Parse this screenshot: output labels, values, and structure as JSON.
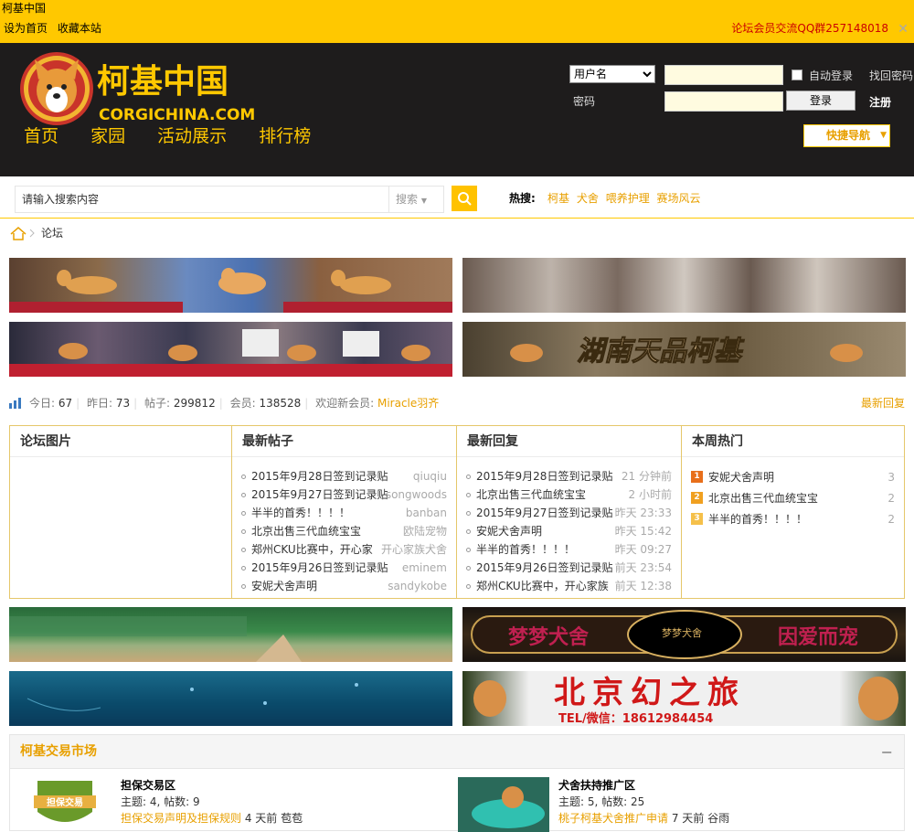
{
  "window_title": "柯基中国",
  "topbar": {
    "set_home": "设为首页",
    "bookmark": "收藏本站",
    "qq_group": "论坛会员交流QQ群257148018",
    "close_icon": "close-icon"
  },
  "logo": {
    "cn": "柯基中国",
    "en": "CORGICHINA.COM"
  },
  "nav": [
    "首页",
    "家园",
    "活动展示",
    "排行榜"
  ],
  "login": {
    "username_select": "用户名",
    "auto_login": "自动登录",
    "find_password": "找回密码",
    "password_label": "密码",
    "login_button": "登录",
    "register": "注册"
  },
  "quick_nav": "快捷导航",
  "search": {
    "placeholder": "请输入搜索内容",
    "type": "搜索",
    "hot_label": "热搜:",
    "hot_links": [
      "柯基",
      "犬舍",
      "喂养护理",
      "赛场风云"
    ]
  },
  "breadcrumb": {
    "current": "论坛"
  },
  "banners": {
    "kennel_right": "湖南天品柯基",
    "dream_left": "梦梦犬舍",
    "dream_right": "因爱而宠",
    "dream_logo": "梦梦犬舍",
    "travel_title": "北京幻之旅",
    "travel_tel": "TEL/微信：18612984454"
  },
  "stats": {
    "today_label": "今日: ",
    "today": "67",
    "yesterday_label": "昨日: ",
    "yesterday": "73",
    "posts_label": "帖子: ",
    "posts": "299812",
    "members_label": "会员: ",
    "members": "138528",
    "welcome_label": "欢迎新会员: ",
    "new_member": "Miracle羽齐",
    "latest_reply": "最新回复"
  },
  "columns": {
    "pictures": {
      "title": "论坛图片"
    },
    "new_posts": {
      "title": "最新帖子",
      "items": [
        {
          "title": "2015年9月28日签到记录贴",
          "author": "qiuqiu"
        },
        {
          "title": "2015年9月27日签到记录贴",
          "author": "songwoods"
        },
        {
          "title": "半半的首秀！！！！",
          "author": "banban"
        },
        {
          "title": "北京出售三代血统宝宝",
          "author": "欧陆宠物"
        },
        {
          "title": "郑州CKU比赛中，开心家",
          "author": "开心家族犬舍"
        },
        {
          "title": "2015年9月26日签到记录贴",
          "author": "eminem"
        },
        {
          "title": "安妮犬舍声明",
          "author": "sandykobe"
        }
      ]
    },
    "new_replies": {
      "title": "最新回复",
      "items": [
        {
          "title": "2015年9月28日签到记录贴",
          "time": "21 分钟前"
        },
        {
          "title": "北京出售三代血统宝宝",
          "time": "2 小时前"
        },
        {
          "title": "2015年9月27日签到记录贴",
          "time": "昨天 23:33"
        },
        {
          "title": "安妮犬舍声明",
          "time": "昨天 15:42"
        },
        {
          "title": "半半的首秀！！！！",
          "time": "昨天 09:27"
        },
        {
          "title": "2015年9月26日签到记录贴",
          "time": "前天 23:54"
        },
        {
          "title": "郑州CKU比赛中，开心家族",
          "time": "前天 12:38"
        }
      ]
    },
    "weekly_hot": {
      "title": "本周热门",
      "items": [
        {
          "rank": "1",
          "title": "安妮犬舍声明",
          "count": "3",
          "color": "#e86f1b"
        },
        {
          "rank": "2",
          "title": "北京出售三代血统宝宝",
          "count": "2",
          "color": "#f0a020"
        },
        {
          "rank": "3",
          "title": "半半的首秀！！！！",
          "count": "2",
          "color": "#f5c04a"
        }
      ]
    }
  },
  "market": {
    "title": "柯基交易市场",
    "collapse": "−",
    "forums": [
      {
        "name": "担保交易区",
        "stats": "主题: 4, 帖数: 9",
        "last_title": "担保交易声明及担保规则",
        "last_time": "4 天前",
        "last_user": "苞苞",
        "badge": "担保交易"
      },
      {
        "name": "犬舍扶持推广区",
        "stats": "主题: 5, 帖数: 25",
        "last_title": "桃子柯基犬舍推广申请",
        "last_time": "7 天前",
        "last_user": "谷雨"
      }
    ]
  },
  "colors": {
    "brand": "#ffc800",
    "link": "#e8a000",
    "header_bg": "#1e1c1c"
  }
}
